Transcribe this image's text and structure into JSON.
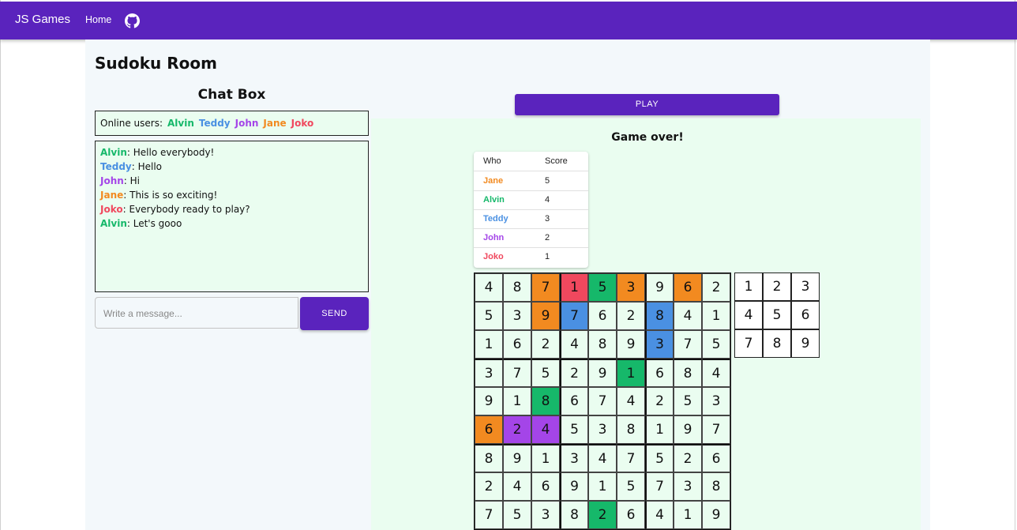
{
  "navbar": {
    "brand": "JS Games",
    "home": "Home",
    "icon": "github-icon"
  },
  "page_title": "Sudoku Room",
  "chat": {
    "title": "Chat Box",
    "online_label": "Online users:",
    "users": [
      {
        "name": "Alvin",
        "color": "#16b86a"
      },
      {
        "name": "Teddy",
        "color": "#4a90e2"
      },
      {
        "name": "John",
        "color": "#a445e8"
      },
      {
        "name": "Jane",
        "color": "#f28a20"
      },
      {
        "name": "Joko",
        "color": "#f0485e"
      }
    ],
    "messages": [
      {
        "user": "Alvin",
        "color": "#16b86a",
        "text": ": Hello everybody!"
      },
      {
        "user": "Teddy",
        "color": "#4a90e2",
        "text": ": Hello"
      },
      {
        "user": "John",
        "color": "#a445e8",
        "text": ": Hi"
      },
      {
        "user": "Jane",
        "color": "#f28a20",
        "text": ": This is so exciting!"
      },
      {
        "user": "Joko",
        "color": "#f0485e",
        "text": ": Everybody ready to play?"
      },
      {
        "user": "Alvin",
        "color": "#16b86a",
        "text": ": Let's gooo"
      }
    ],
    "input_placeholder": "Write a message...",
    "send_label": "SEND"
  },
  "game": {
    "play_label": "PLAY",
    "status": "Game over!",
    "score_headers": {
      "who": "Who",
      "score": "Score"
    },
    "scores": [
      {
        "who": "Jane",
        "score": "5",
        "color": "#f28a20"
      },
      {
        "who": "Alvin",
        "score": "4",
        "color": "#16b86a"
      },
      {
        "who": "Teddy",
        "score": "3",
        "color": "#4a90e2"
      },
      {
        "who": "John",
        "score": "2",
        "color": "#a445e8"
      },
      {
        "who": "Joko",
        "score": "1",
        "color": "#f0485e"
      }
    ],
    "board": [
      [
        4,
        8,
        7,
        1,
        5,
        3,
        9,
        6,
        2
      ],
      [
        5,
        3,
        9,
        7,
        6,
        2,
        8,
        4,
        1
      ],
      [
        1,
        6,
        2,
        4,
        8,
        9,
        3,
        7,
        5
      ],
      [
        3,
        7,
        5,
        2,
        9,
        1,
        6,
        8,
        4
      ],
      [
        9,
        1,
        8,
        6,
        7,
        4,
        2,
        5,
        3
      ],
      [
        6,
        2,
        4,
        5,
        3,
        8,
        1,
        9,
        7
      ],
      [
        8,
        9,
        1,
        3,
        4,
        7,
        5,
        2,
        6
      ],
      [
        2,
        4,
        6,
        9,
        1,
        5,
        7,
        3,
        8
      ],
      [
        7,
        5,
        3,
        8,
        2,
        6,
        4,
        1,
        9
      ]
    ],
    "claimed_cells": [
      {
        "row": 0,
        "col": 2,
        "color": "#f28a20"
      },
      {
        "row": 0,
        "col": 3,
        "color": "#f0485e"
      },
      {
        "row": 0,
        "col": 4,
        "color": "#16b86a"
      },
      {
        "row": 0,
        "col": 5,
        "color": "#f28a20"
      },
      {
        "row": 0,
        "col": 7,
        "color": "#f28a20"
      },
      {
        "row": 1,
        "col": 2,
        "color": "#f28a20"
      },
      {
        "row": 1,
        "col": 3,
        "color": "#4a90e2"
      },
      {
        "row": 1,
        "col": 6,
        "color": "#4a90e2"
      },
      {
        "row": 2,
        "col": 6,
        "color": "#4a90e2"
      },
      {
        "row": 3,
        "col": 5,
        "color": "#16b86a"
      },
      {
        "row": 4,
        "col": 2,
        "color": "#16b86a"
      },
      {
        "row": 5,
        "col": 0,
        "color": "#f28a20"
      },
      {
        "row": 5,
        "col": 1,
        "color": "#a445e8"
      },
      {
        "row": 5,
        "col": 2,
        "color": "#a445e8"
      },
      {
        "row": 8,
        "col": 4,
        "color": "#16b86a"
      }
    ],
    "number_pad": [
      1,
      2,
      3,
      4,
      5,
      6,
      7,
      8,
      9
    ]
  }
}
